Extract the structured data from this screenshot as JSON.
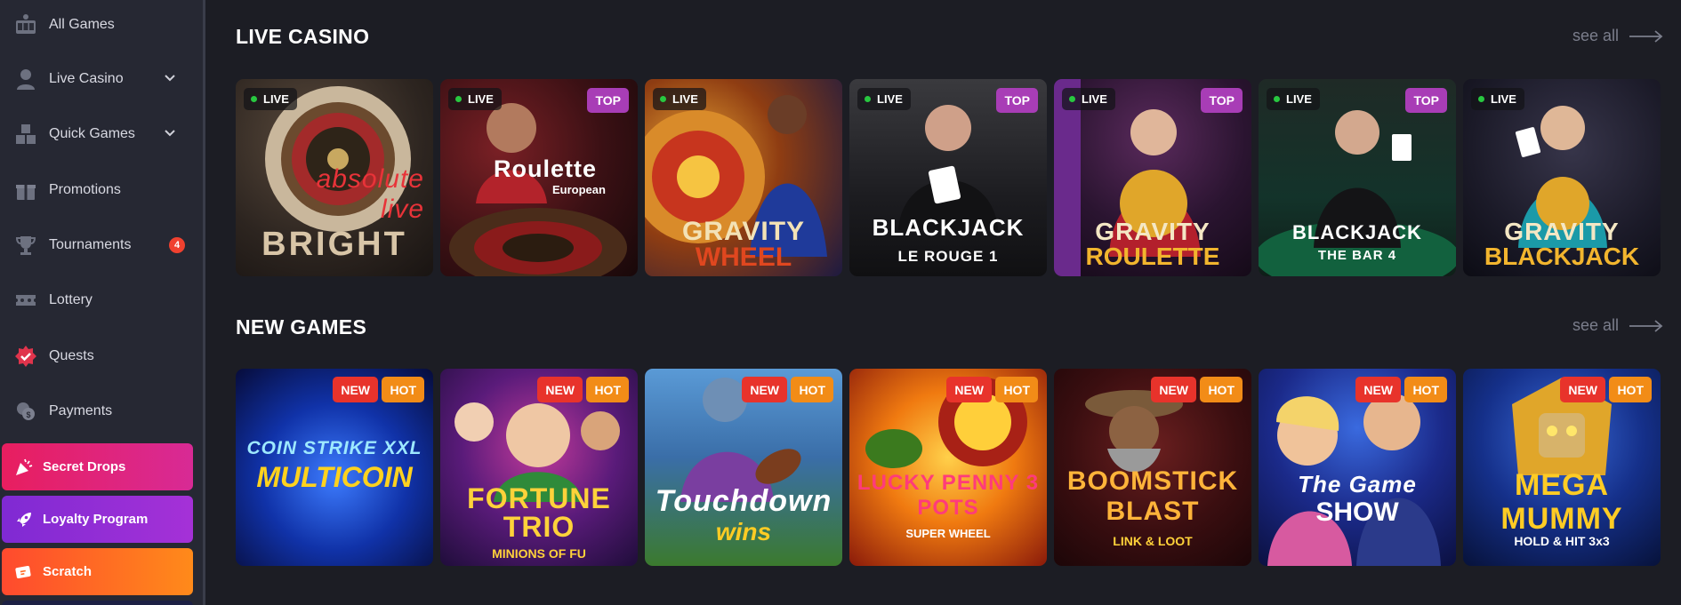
{
  "sidebar": {
    "items": [
      {
        "label": "All Games",
        "icon": "slot-machine-icon",
        "chevron": false
      },
      {
        "label": "Live Casino",
        "icon": "dealer-icon",
        "chevron": true
      },
      {
        "label": "Quick Games",
        "icon": "blocks-icon",
        "chevron": true
      },
      {
        "label": "Promotions",
        "icon": "gift-icon",
        "chevron": false
      },
      {
        "label": "Tournaments",
        "icon": "trophy-icon",
        "chevron": false,
        "badge": "4"
      },
      {
        "label": "Lottery",
        "icon": "ticket-icon",
        "chevron": false
      },
      {
        "label": "Quests",
        "icon": "quest-badge-icon",
        "chevron": false
      },
      {
        "label": "Payments",
        "icon": "coins-icon",
        "chevron": false
      }
    ],
    "promos": [
      {
        "label": "Secret Drops",
        "icon": "party-popper-icon"
      },
      {
        "label": "Loyalty Program",
        "icon": "rocket-icon"
      },
      {
        "label": "Scratch",
        "icon": "scratch-card-icon"
      }
    ]
  },
  "live_casino": {
    "title": "LIVE CASINO",
    "see_all": "see all",
    "games": [
      {
        "title": "BRIGHT",
        "subtitle": "absolute live",
        "live_label": "LIVE",
        "top_label": ""
      },
      {
        "title": "Roulette",
        "subtitle": "European",
        "live_label": "LIVE",
        "top_label": "TOP"
      },
      {
        "title": "GRAVITY",
        "subtitle": "WHEEL",
        "live_label": "LIVE",
        "top_label": ""
      },
      {
        "title": "BLACKJACK",
        "subtitle": "LE ROUGE 1",
        "live_label": "LIVE",
        "top_label": "TOP"
      },
      {
        "title": "GRAVITY",
        "subtitle": "ROULETTE",
        "live_label": "LIVE",
        "top_label": "TOP"
      },
      {
        "title": "BLACKJACK",
        "subtitle": "THE BAR 4",
        "live_label": "LIVE",
        "top_label": "TOP"
      },
      {
        "title": "GRAVITY",
        "subtitle": "BLACKJACK",
        "live_label": "LIVE",
        "top_label": ""
      }
    ]
  },
  "new_games": {
    "title": "NEW GAMES",
    "see_all": "see all",
    "games": [
      {
        "title": "COIN STRIKE XXL",
        "subtitle": "MULTICOIN",
        "new_label": "NEW",
        "hot_label": "HOT"
      },
      {
        "title": "FORTUNE TRIO",
        "subtitle": "MINIONS OF FU",
        "new_label": "NEW",
        "hot_label": "HOT"
      },
      {
        "title": "Touchdown",
        "subtitle": "wins",
        "new_label": "NEW",
        "hot_label": "HOT"
      },
      {
        "title": "LUCKY PENNY 3 POTS",
        "subtitle": "SUPER WHEEL",
        "new_label": "NEW",
        "hot_label": "HOT"
      },
      {
        "title": "BOOMSTICK BLAST",
        "subtitle": "LINK & LOOT",
        "new_label": "NEW",
        "hot_label": "HOT"
      },
      {
        "title": "The Game",
        "subtitle": "SHOW",
        "new_label": "NEW",
        "hot_label": "HOT"
      },
      {
        "title": "MEGA MUMMY",
        "subtitle": "HOLD & HIT 3x3",
        "new_label": "NEW",
        "hot_label": "HOT"
      }
    ]
  },
  "colors": {
    "background": "#1c1d24",
    "sidebar": "#262833",
    "live_dot": "#28c840",
    "top_tag": "#a83db6",
    "new_tag": "#e8332b",
    "hot_tag": "#f28c17",
    "badge": "#f0412f"
  }
}
